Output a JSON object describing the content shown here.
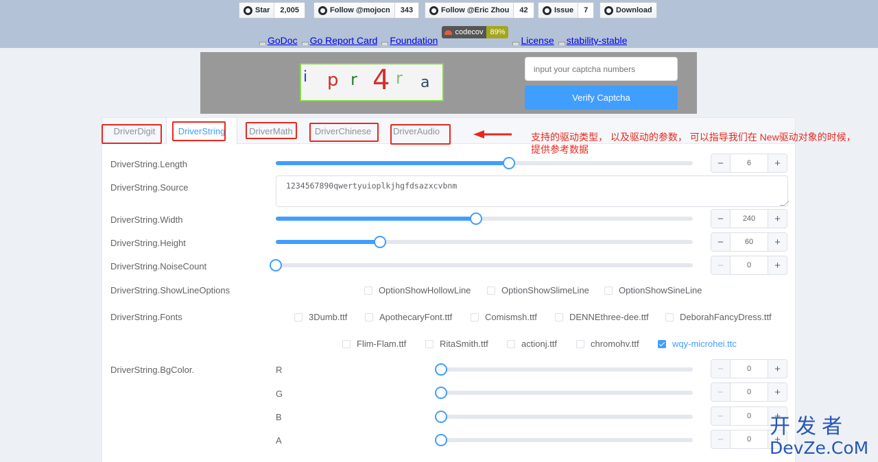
{
  "header": {
    "github_buttons": [
      {
        "label": "Star",
        "count": "2,005"
      },
      {
        "label": "Follow @mojocn",
        "count": "343"
      },
      {
        "label": "Follow @Eric Zhou",
        "count": "42"
      },
      {
        "label": "Issue",
        "count": "7"
      },
      {
        "label": "Download"
      }
    ],
    "badges": {
      "godoc": "GoDoc",
      "goreport": "Go Report Card",
      "foundation": "Foundation",
      "codecov_label": "codecov",
      "codecov_value": "89%",
      "license": "License",
      "stability": "stability-stable"
    }
  },
  "captcha": {
    "chars": [
      "i",
      "p",
      "r",
      "4",
      "r",
      "a"
    ],
    "input_placeholder": "input your captcha numbers",
    "verify_label": "Verify Captcha"
  },
  "tabs": [
    {
      "label": "DriverDigit",
      "active": false
    },
    {
      "label": "DriverString",
      "active": true
    },
    {
      "label": "DriverMath",
      "active": false
    },
    {
      "label": "DriverChinese",
      "active": false
    },
    {
      "label": "DriverAudio",
      "active": false
    }
  ],
  "annotation": {
    "text": "支持的驱动类型， 以及驱动的参数， 可以指导我们在 New驱动对象的时候，提供参考数据"
  },
  "form": {
    "length": {
      "label": "DriverString.Length",
      "value": "6",
      "level": 0.56
    },
    "source": {
      "label": "DriverString.Source",
      "value": "1234567890qwertyuioplkjhgfdsazxcvbnm"
    },
    "width": {
      "label": "DriverString.Width",
      "value": "240",
      "level": 0.48
    },
    "height": {
      "label": "DriverString.Height",
      "value": "60",
      "level": 0.25
    },
    "noise": {
      "label": "DriverString.NoiseCount",
      "value": "0",
      "level": 0
    },
    "show_line": {
      "label": "DriverString.ShowLineOptions",
      "options": [
        "OptionShowHollowLine",
        "OptionShowSlimeLine",
        "OptionShowSineLine"
      ]
    },
    "fonts": {
      "label": "DriverString.Fonts",
      "row1": [
        "3Dumb.ttf",
        "ApothecaryFont.ttf",
        "Comismsh.ttf",
        "DENNEthree-dee.ttf",
        "DeborahFancyDress.ttf"
      ],
      "row2": [
        "Flim-Flam.ttf",
        "RitaSmith.ttf",
        "actionj.ttf",
        "chromohv.ttf",
        "wqy-microhei.ttc"
      ],
      "checked": "wqy-microhei.ttc"
    },
    "bgcolor": {
      "label": "DriverString.BgColor.",
      "channels": [
        {
          "name": "R",
          "value": "0"
        },
        {
          "name": "G",
          "value": "0"
        },
        {
          "name": "B",
          "value": "0"
        },
        {
          "name": "A",
          "value": "0"
        }
      ]
    }
  },
  "stepper": {
    "minus": "−",
    "plus": "+"
  },
  "watermark": {
    "cn": "开发者",
    "en": "DevZe.CoM"
  },
  "colors": {
    "accent": "#409eff",
    "annotation": "#e8281e",
    "header_bg": "#b3c2d6"
  }
}
